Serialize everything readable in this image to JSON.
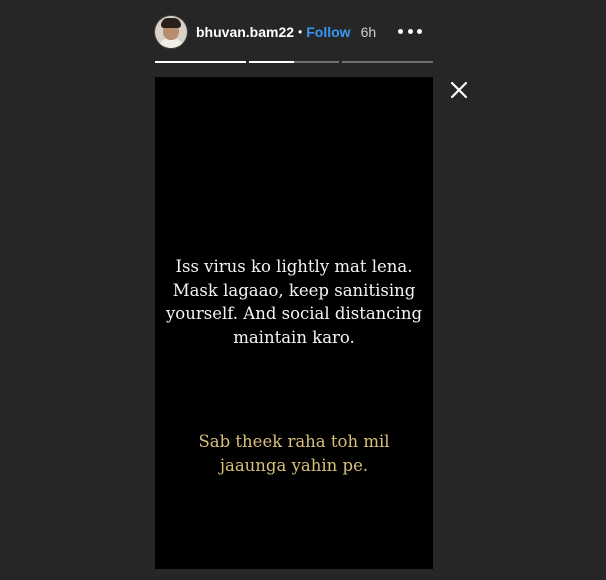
{
  "header": {
    "username": "bhuvan.bam22",
    "separator": "•",
    "follow_label": "Follow",
    "time_ago": "6h"
  },
  "icons": {
    "avatar": "profile-avatar",
    "more": "more-options-icon",
    "close": "close-icon"
  },
  "progress": {
    "segments": [
      1.0,
      0.5,
      0.0
    ]
  },
  "story": {
    "message_primary": "Iss virus ko lightly mat lena. Mask lagaao, keep sanitising yourself. And social distancing maintain karo.",
    "message_secondary": "Sab theek raha toh mil jaaunga yahin pe."
  },
  "colors": {
    "background": "#262626",
    "story_background": "#000000",
    "follow": "#3897f0",
    "secondary_text": "#d8bf7a"
  }
}
